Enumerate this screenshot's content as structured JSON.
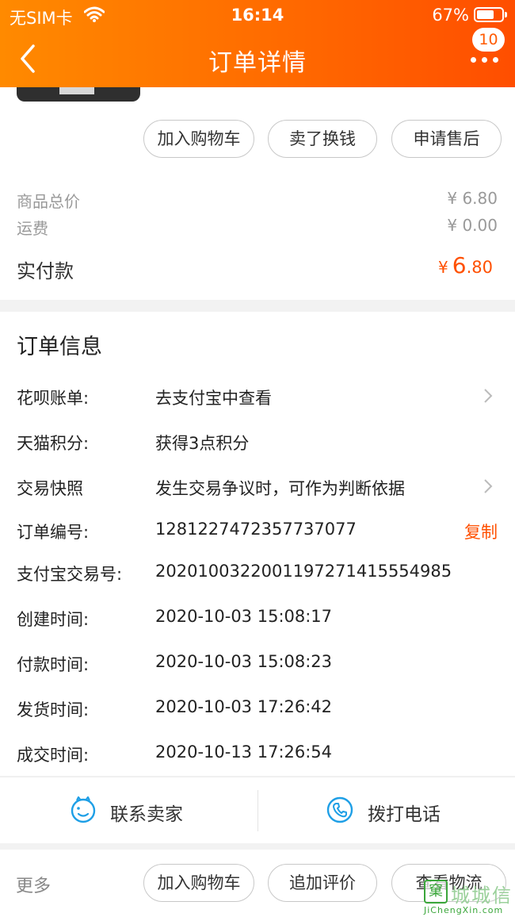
{
  "status_bar": {
    "carrier": "无SIM卡",
    "time": "16:14",
    "battery": "67%"
  },
  "nav": {
    "title": "订单详情",
    "badge": "10"
  },
  "actions_top": [
    "加入购物车",
    "卖了换钱",
    "申请售后"
  ],
  "fees": [
    {
      "label": "商品总价",
      "value": "¥ 6.80"
    },
    {
      "label": "运费",
      "value": "¥ 0.00"
    }
  ],
  "paid": {
    "label": "实付款",
    "currency": "¥",
    "int": "6",
    "dec": ".80"
  },
  "order_info": {
    "title": "订单信息",
    "rows": [
      {
        "label": "花呗账单:",
        "value": "去支付宝中查看"
      },
      {
        "label": "天猫积分:",
        "value": "获得3点积分"
      },
      {
        "label": "交易快照",
        "value": "发生交易争议时，可作为判断依据"
      },
      {
        "label": "订单编号:",
        "value": "1281227472357737077",
        "action": "复制"
      },
      {
        "label": "支付宝交易号:",
        "value": "2020100322001197271415554985"
      },
      {
        "label": "创建时间:",
        "value": "2020-10-03 15:08:17"
      },
      {
        "label": "付款时间:",
        "value": "2020-10-03 15:08:23"
      },
      {
        "label": "发货时间:",
        "value": "2020-10-03 17:26:42"
      },
      {
        "label": "成交时间:",
        "value": "2020-10-13 17:26:54"
      }
    ]
  },
  "contact": {
    "seller": "联系卖家",
    "phone": "拨打电话"
  },
  "bottom": {
    "more": "更多",
    "buttons": [
      "加入购物车",
      "追加评价",
      "查看物流"
    ]
  },
  "watermark": {
    "logo": "窠",
    "text": "城城信",
    "sub": "JiChengXin.com"
  },
  "colors": {
    "accent": "#ff5000",
    "header_from": "#ff8a00",
    "header_to": "#ff4e00"
  },
  "icons": [
    "back-icon",
    "more-icon",
    "wifi-icon",
    "battery-icon",
    "chevron-right-icon",
    "smile-chat-icon",
    "phone-icon"
  ]
}
